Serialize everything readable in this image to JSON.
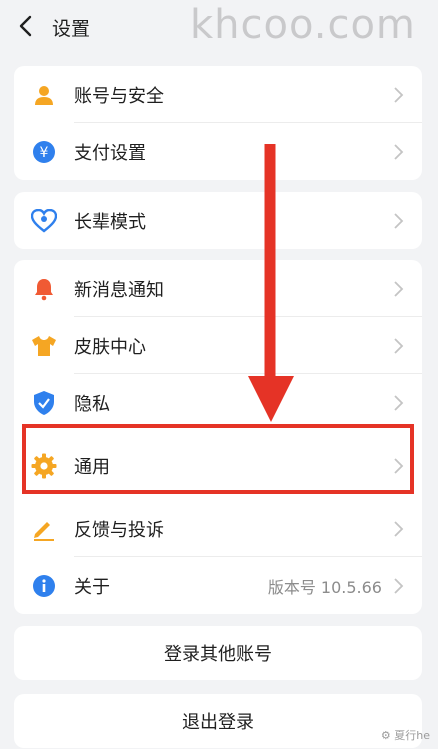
{
  "header": {
    "title": "设置",
    "back_icon": "chevron-left-icon"
  },
  "watermark": "khcoo.com",
  "groups": [
    {
      "items": [
        {
          "label": "账号与安全",
          "icon": "user-icon",
          "color": "#f5a623"
        },
        {
          "label": "支付设置",
          "icon": "yuan-icon",
          "color": "#2f80ed"
        }
      ]
    },
    {
      "items": [
        {
          "label": "长辈模式",
          "icon": "heart-icon",
          "color": "#2f80ed"
        }
      ]
    },
    {
      "items": [
        {
          "label": "新消息通知",
          "icon": "bell-icon",
          "color": "#f05a34"
        },
        {
          "label": "皮肤中心",
          "icon": "shirt-icon",
          "color": "#f5a623"
        },
        {
          "label": "隐私",
          "icon": "shield-icon",
          "color": "#2f80ed"
        },
        {
          "label": "通用",
          "icon": "gear-icon",
          "color": "#f5a623"
        },
        {
          "label": "反馈与投诉",
          "icon": "edit-icon",
          "color": "#f5a623"
        },
        {
          "label": "关于",
          "icon": "info-icon",
          "color": "#2f80ed",
          "value": "版本号 10.5.66"
        }
      ]
    }
  ],
  "buttons": {
    "switch_account": "登录其他账号",
    "logout": "退出登录"
  },
  "annotation": {
    "color": "#e53326"
  },
  "bottom_watermark": "⚙ 夏行he"
}
